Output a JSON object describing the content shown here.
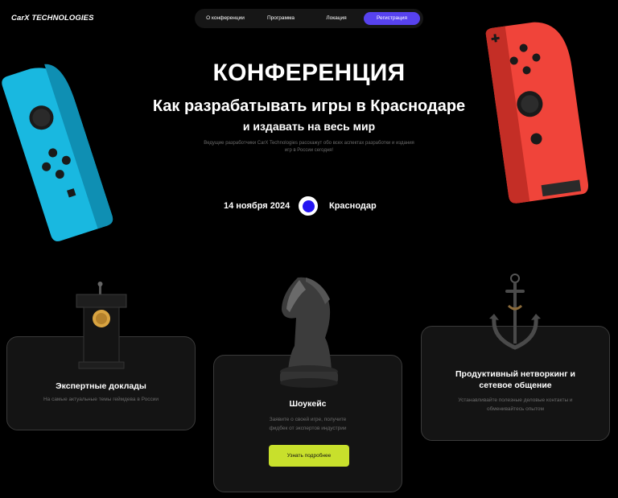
{
  "header": {
    "logo": "CarX TECHNOLOGIES",
    "nav": [
      {
        "label": "О конференции"
      },
      {
        "label": "Программа"
      },
      {
        "label": "Локация"
      },
      {
        "label": "Регистрация"
      }
    ]
  },
  "hero": {
    "title": "КОНФЕРЕНЦИЯ",
    "subtitle": "Как разрабатывать игры в Краснодаре",
    "subtitle2": "и издавать на весь мир",
    "description": "Ведущие разработчики CarX Technologies расскажут обо всех аспектах разработки и издания игр в России сегодня!",
    "date": "14 ноября 2024",
    "city": "Краснодар"
  },
  "cards": [
    {
      "title": "Экспертные доклады",
      "description": "На самые актуальные темы геймдева в России",
      "icon": "podium-icon"
    },
    {
      "title": "Шоукейс",
      "description": "Заявите о своей игре, получите фидбек от экспертов индустрии",
      "button": "Узнать подробнее",
      "icon": "chess-knight-icon"
    },
    {
      "title": "Продуктивный нетворкинг и сетевое общение",
      "description": "Устанавливайте полезные деловые контакты и обменивайтесь опытом",
      "icon": "anchor-icon"
    }
  ],
  "colors": {
    "accent": "#5742ee",
    "cta": "#c8e02c",
    "background": "#000000",
    "card": "#141414",
    "dot": "#2414f2",
    "joycon_left": "#19b8e0",
    "joycon_right": "#f0443a"
  }
}
